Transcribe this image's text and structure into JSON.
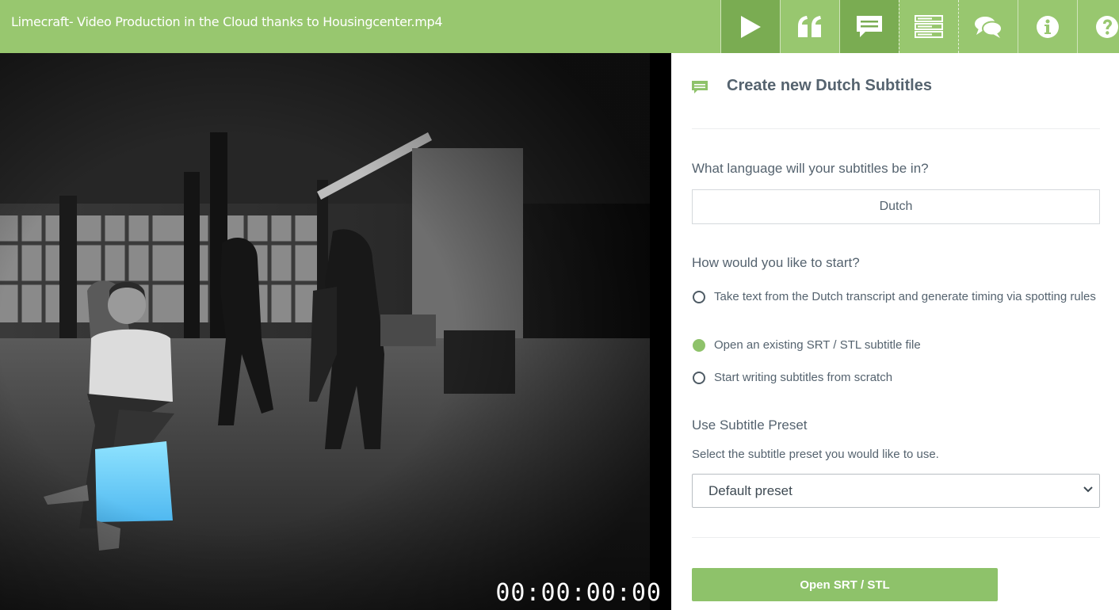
{
  "header": {
    "title": "Limecraft- Video Production in the Cloud thanks to Housingcenter.mp4"
  },
  "toolbar": {
    "items": [
      {
        "icon": "play-icon",
        "active": true
      },
      {
        "icon": "quote-icon",
        "active": false
      },
      {
        "icon": "subtitle-icon",
        "active": true
      },
      {
        "icon": "list-icon",
        "active": false
      },
      {
        "icon": "comments-icon",
        "active": false
      },
      {
        "icon": "info-icon",
        "active": false
      },
      {
        "icon": "help-icon",
        "active": false
      }
    ]
  },
  "video": {
    "timecode": "00:00:00:00"
  },
  "panel": {
    "title": "Create new Dutch Subtitles",
    "language_question": "What language will your subtitles be in?",
    "language_value": "Dutch",
    "start_question": "How would you like to start?",
    "options": [
      {
        "label": "Take text from the Dutch transcript and generate timing via spotting rules",
        "checked": false
      },
      {
        "label": "Open an existing SRT / STL subtitle file",
        "checked": true
      },
      {
        "label": "Start writing subtitles from scratch",
        "checked": false
      }
    ],
    "preset_heading": "Use Subtitle Preset",
    "preset_hint": "Select the subtitle preset you would like to use.",
    "preset_value": "Default preset",
    "submit_label": "Open SRT / STL"
  },
  "colors": {
    "brand_green": "#98c76f",
    "active_tool": "#7aac52",
    "accent": "#8ec26a",
    "text": "#55636f"
  }
}
